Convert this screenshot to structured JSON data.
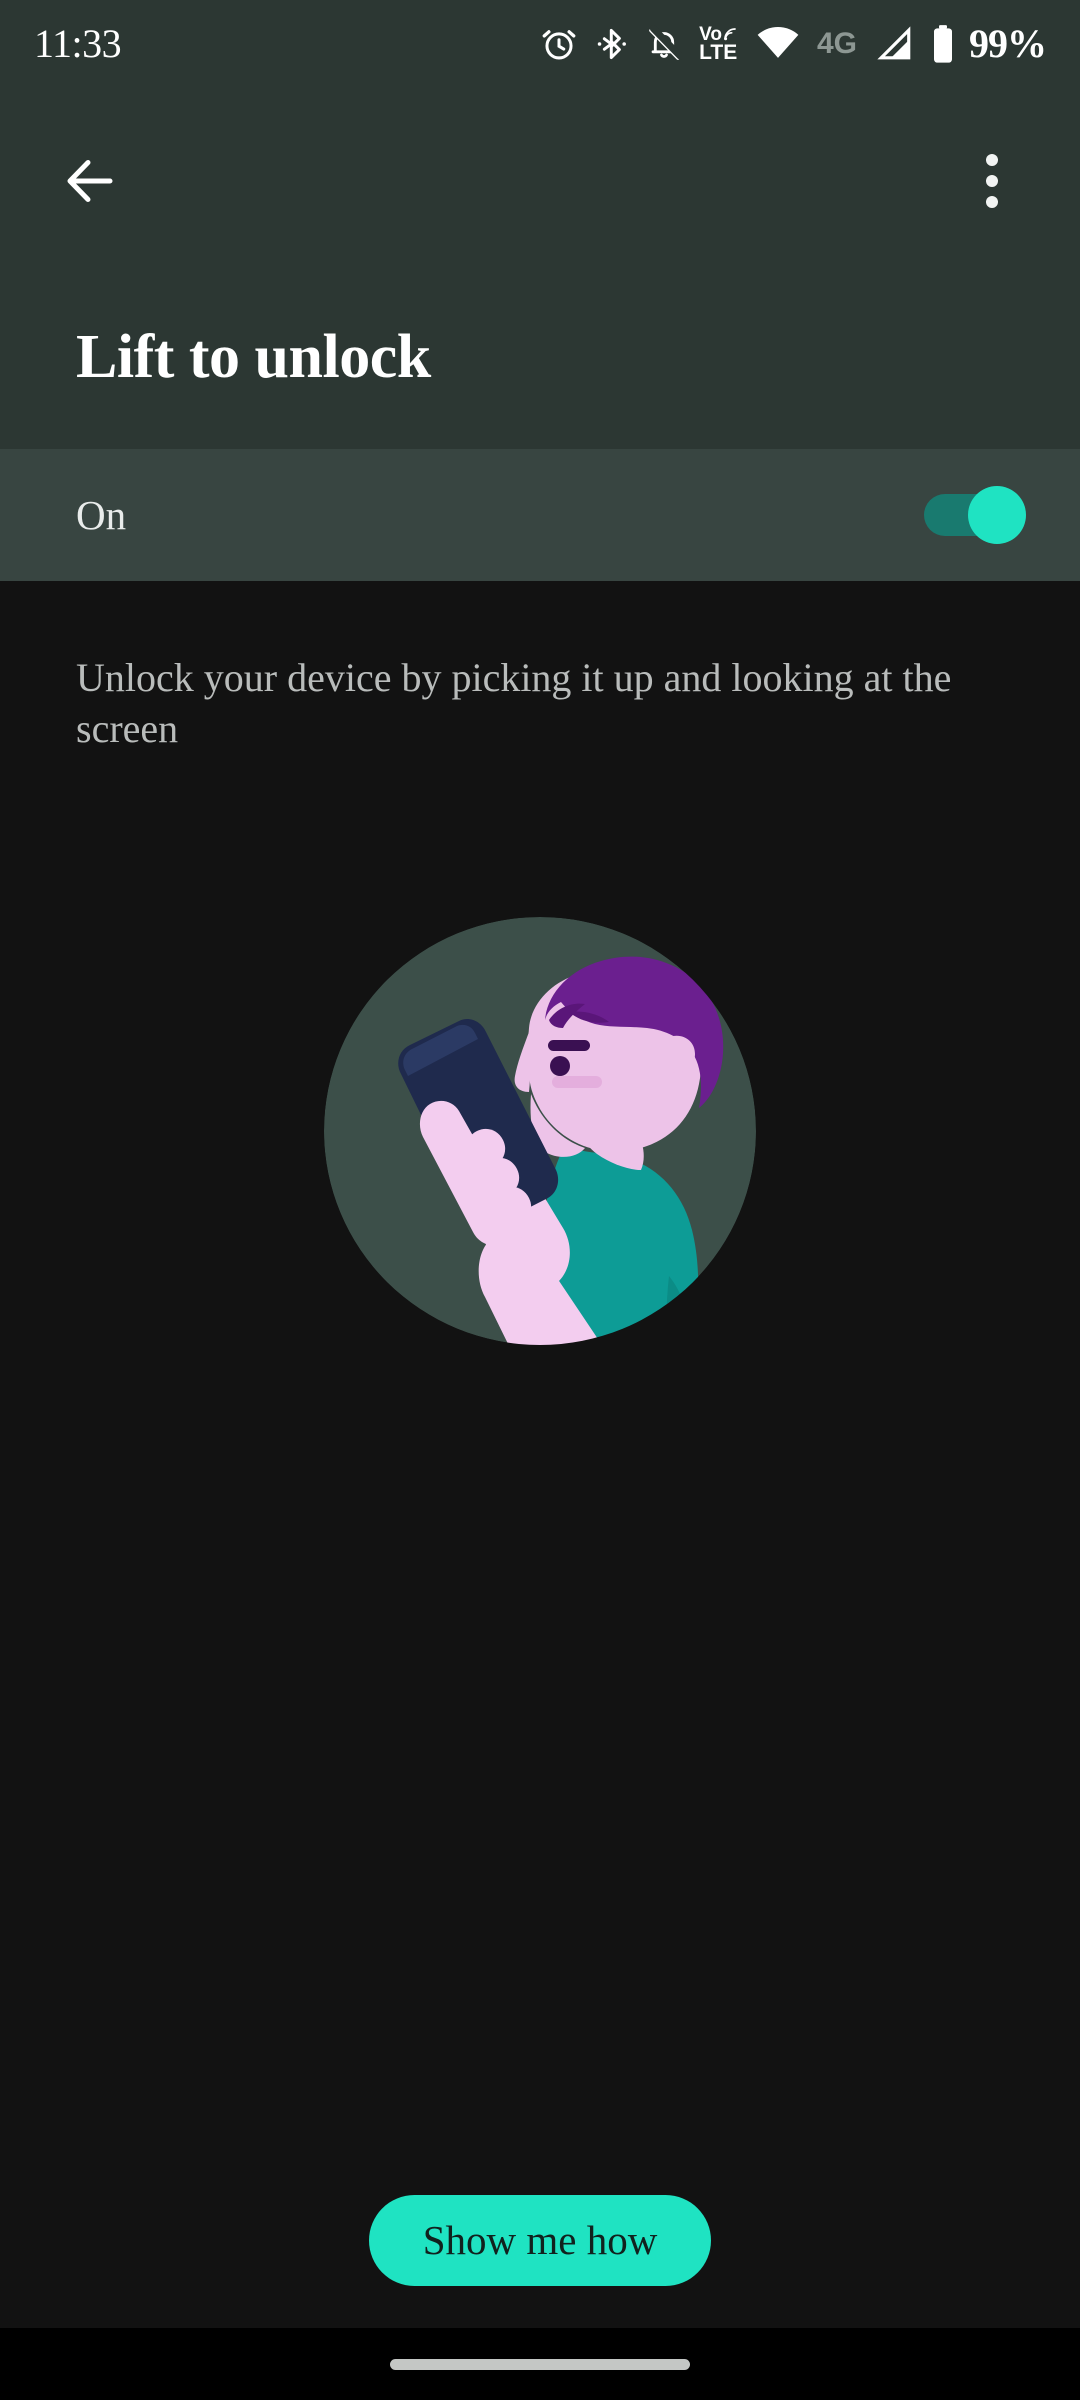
{
  "status_bar": {
    "time": "11:33",
    "battery_percent": "99%",
    "network_label": "4G",
    "volte_top": "Vo",
    "volte_bottom": "LTE",
    "icons": [
      "alarm-icon",
      "bluetooth-icon",
      "notifications-off-icon",
      "volte-icon",
      "wifi-icon",
      "network-4g-label",
      "cellular-signal-icon",
      "battery-icon"
    ]
  },
  "app_bar": {
    "back_label": "Back",
    "overflow_label": "More options",
    "title": "Lift to unlock"
  },
  "toggle_row": {
    "label": "On",
    "state": "on"
  },
  "body": {
    "description": "Unlock your device by picking it up and looking at the screen"
  },
  "illustration": {
    "name": "lift-to-unlock-illustration",
    "alt": "Person lifting phone and looking at the screen"
  },
  "footer": {
    "primary_button": "Show me how"
  },
  "colors": {
    "status_bar_bg": "#2c3733",
    "app_bar_bg": "#2c3733",
    "toggle_row_bg": "#384541",
    "body_bg": "#121212",
    "accent": "#1fe3c2",
    "switch_track": "#197a6f",
    "title_text": "#ffffff",
    "description_text": "#b9bcbb",
    "illustration_circle": "#3c4f49",
    "illustration_hair": "#6b1f8f",
    "illustration_skin": "#edc3e8",
    "illustration_shirt": "#0d9c96",
    "illustration_phone": "#1f2a4d",
    "nav_bar_bg": "#000000",
    "nav_pill": "#c4c7c5"
  }
}
